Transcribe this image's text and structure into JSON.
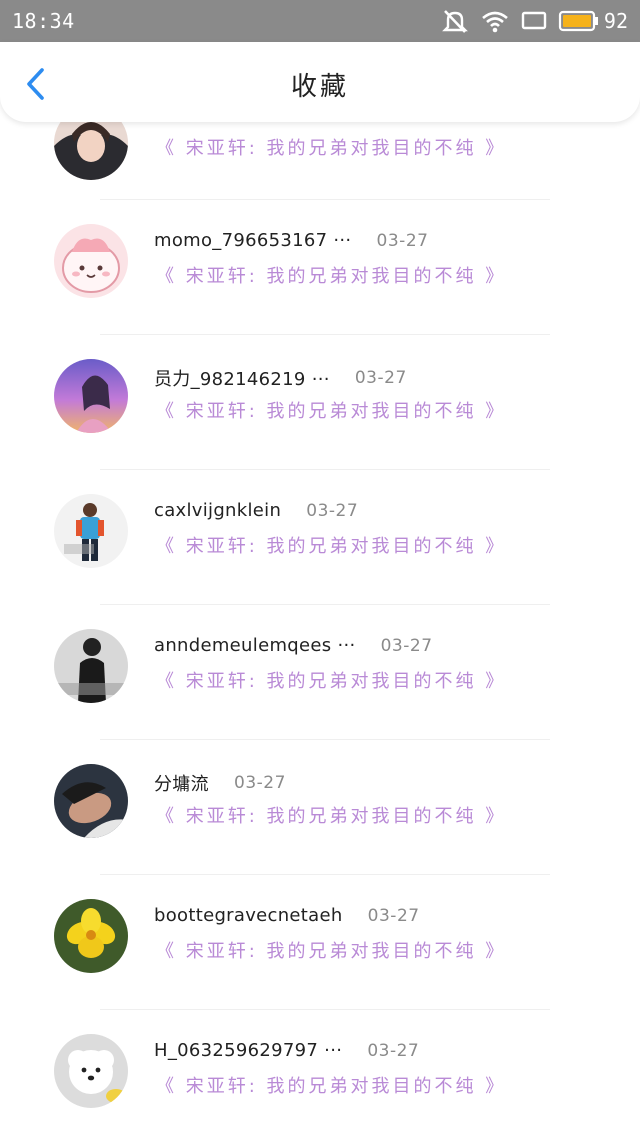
{
  "status_bar": {
    "time": "18:34",
    "battery_level": "92",
    "icons": [
      "mute-icon",
      "wifi-icon",
      "screen-icon",
      "battery-icon"
    ]
  },
  "nav": {
    "title": "收藏",
    "back_icon": "chevron-left-icon",
    "accent": "#2d8cf0"
  },
  "colors": {
    "quote": "#b98ad6",
    "date": "#8a8a8a",
    "status_bar_bg": "#8a8a8a"
  },
  "items": [
    {
      "name": "",
      "date": "",
      "quote": "《 宋亚轩: 我的兄弟对我目的不纯 》"
    },
    {
      "name": "momo_796653167 ···",
      "date": "03-27",
      "quote": "《 宋亚轩: 我的兄弟对我目的不纯 》"
    },
    {
      "name": "员力_982146219 ···",
      "date": "03-27",
      "quote": "《 宋亚轩: 我的兄弟对我目的不纯 》"
    },
    {
      "name": "caxlvijgnklein",
      "date": "03-27",
      "quote": "《 宋亚轩: 我的兄弟对我目的不纯 》"
    },
    {
      "name": "anndemeulemqees ···",
      "date": "03-27",
      "quote": "《 宋亚轩: 我的兄弟对我目的不纯 》"
    },
    {
      "name": "分墉流",
      "date": "03-27",
      "quote": "《 宋亚轩: 我的兄弟对我目的不纯 》"
    },
    {
      "name": "boottegravecnetaeh",
      "date": "03-27",
      "quote": "《 宋亚轩: 我的兄弟对我目的不纯 》"
    },
    {
      "name": "H_063259629797 ···",
      "date": "03-27",
      "quote": "《 宋亚轩: 我的兄弟对我目的不纯 》"
    }
  ]
}
